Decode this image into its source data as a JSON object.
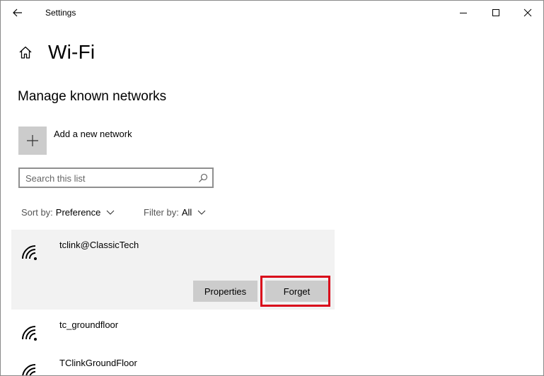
{
  "window": {
    "title": "Settings"
  },
  "header": {
    "page_title": "Wi-Fi",
    "section_title": "Manage known networks"
  },
  "add_network": {
    "label": "Add a new network"
  },
  "search": {
    "placeholder": "Search this list",
    "value": ""
  },
  "sort": {
    "label": "Sort by:",
    "value": "Preference"
  },
  "filter": {
    "label": "Filter by:",
    "value": "All"
  },
  "networks": [
    {
      "name": "tclink@ClassicTech",
      "selected": true
    },
    {
      "name": "tc_groundfloor",
      "selected": false
    },
    {
      "name": "TClinkGroundFloor",
      "selected": false
    }
  ],
  "actions": {
    "properties_label": "Properties",
    "forget_label": "Forget"
  },
  "colors": {
    "highlight": "#d9071a",
    "button_bg": "#cccccc",
    "selected_bg": "#f2f2f2"
  },
  "icons": {
    "back": "back-arrow-icon",
    "home": "home-icon",
    "add": "plus-icon",
    "search": "search-icon",
    "wifi": "wifi-signal-icon",
    "chevron": "chevron-down-icon"
  }
}
